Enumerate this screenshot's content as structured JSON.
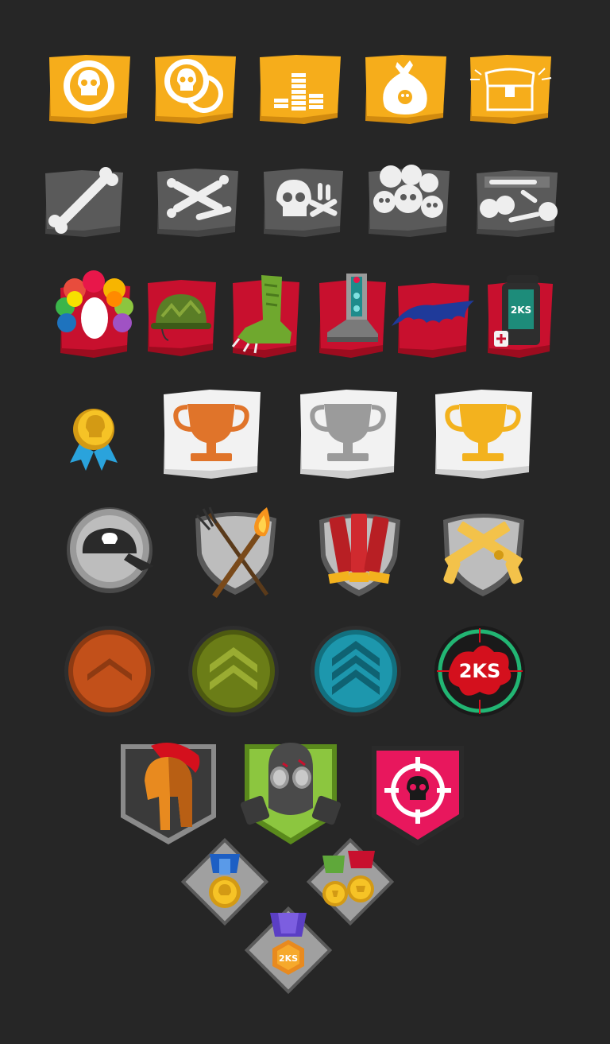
{
  "sheet": "achievement-badges",
  "colors": {
    "background": "#262626",
    "gold": "#f6ad1b",
    "stone": "#575757",
    "red": "#c8102e",
    "paper": "#f2f2f2",
    "shield": "#8f8f8f",
    "rank_orange": "#c2501a",
    "rank_olive": "#6b7d17",
    "rank_teal": "#1d97ad",
    "pink": "#e8175d",
    "green": "#8cc63f",
    "purple": "#5b3fc4"
  },
  "brand": {
    "text": "2KS"
  },
  "rows": {
    "coins": [
      "skull-coin-icon",
      "skull-coins-pair-icon",
      "coin-stacks-icon",
      "money-bag-icon",
      "treasure-chest-icon"
    ],
    "bones": [
      "single-bone-icon",
      "crossed-bones-icon",
      "skull-and-bones-icon",
      "skull-pile-icon",
      "bone-crate-icon"
    ],
    "gear": [
      "clown-wig-icon",
      "army-helmet-icon",
      "zombie-leg-icon",
      "robot-leg-icon",
      "bat-wings-icon",
      "jetpack-icon"
    ],
    "trophies": [
      "ribbon-medal-icon",
      "bronze-trophy-icon",
      "silver-trophy-icon",
      "gold-trophy-icon"
    ],
    "emblems": [
      "skull-cap-icon",
      "pitchfork-torch-icon",
      "shotgun-shells-icon",
      "crossed-pistols-icon"
    ],
    "ranks": [
      "rank-one-chevron-icon",
      "rank-two-chevron-icon",
      "rank-three-chevron-icon",
      "splat-2ks-icon"
    ],
    "crests": [
      "spartan-helmet-icon",
      "gas-mask-icon",
      "skull-crosshair-icon"
    ],
    "medals": [
      "blue-medal-icon",
      "double-medal-icon",
      "purple-2ks-medal-icon"
    ]
  }
}
